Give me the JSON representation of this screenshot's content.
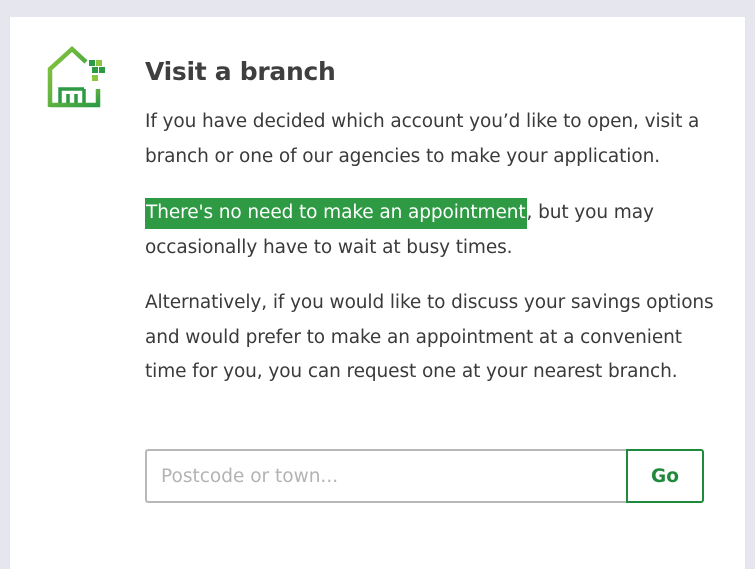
{
  "branch": {
    "icon": "house-branch-icon",
    "title": "Visit a branch",
    "intro": "If you have decided which account you’d like to open, visit a branch or one of our agencies to make your application.",
    "highlight": "There's no need to make an appointment",
    "highlight_rest": ", but you may occasionally have to wait at busy times.",
    "alternative": "Alternatively, if you would like to discuss your savings options and would prefer to make an appointment at a convenient time for you, you can request one at your nearest branch."
  },
  "search": {
    "placeholder": "Postcode or town...",
    "value": "",
    "go_label": "Go"
  },
  "colors": {
    "accent_green": "#2e9a44",
    "button_green": "#1f8a3b",
    "background": "#e6e7ee"
  }
}
